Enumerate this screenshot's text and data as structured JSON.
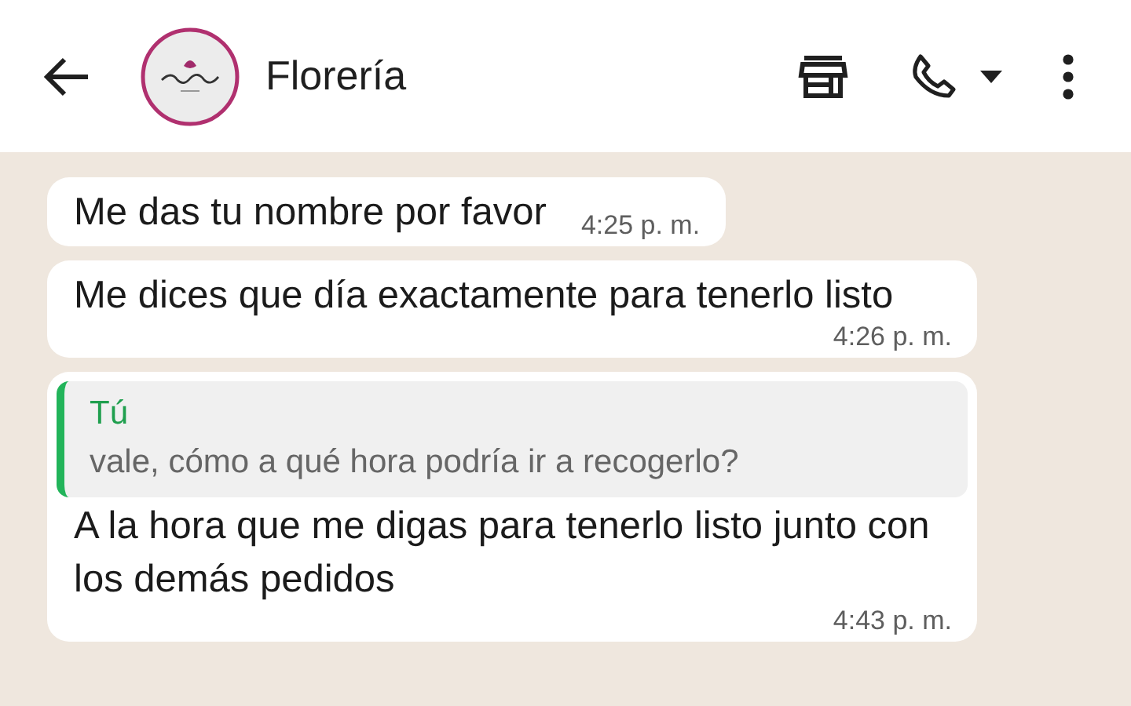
{
  "header": {
    "title": "Florería"
  },
  "messages": [
    {
      "kind": "text",
      "text": "Me das tu nombre por favor",
      "time": "4:25 p. m."
    },
    {
      "kind": "text",
      "text": "Me dices que día exactamente para tenerlo listo",
      "time": "4:26 p. m."
    },
    {
      "kind": "reply",
      "quote": {
        "author": "Tú",
        "text": "vale, cómo a qué hora podría ir a recogerlo?"
      },
      "text": "A la hora que me digas para tenerlo listo junto con los demás pedidos",
      "time": "4:43 p. m."
    }
  ]
}
